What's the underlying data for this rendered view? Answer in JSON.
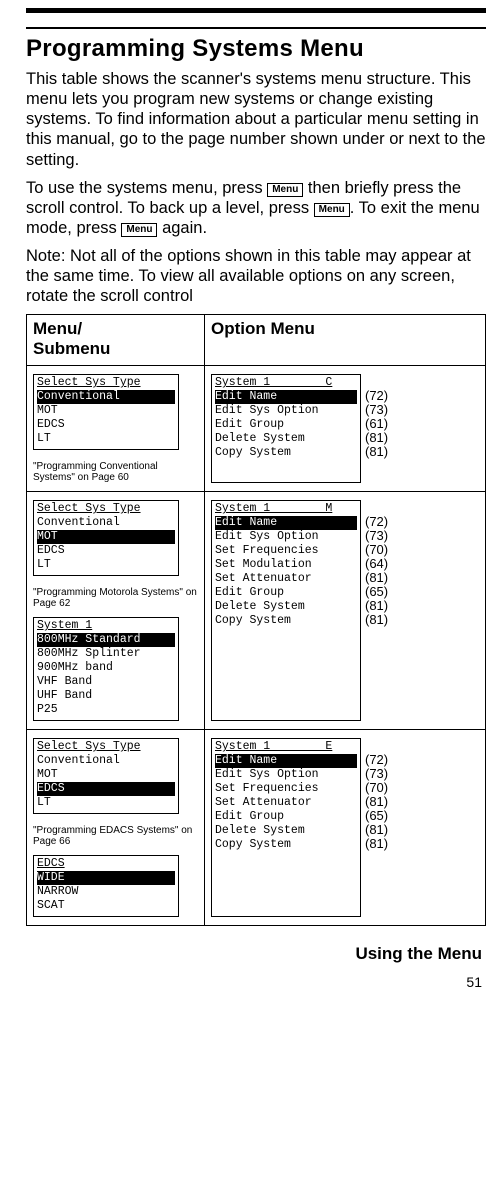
{
  "title": "Programming Systems Menu",
  "para1": "This table shows the scanner's systems menu structure. This menu lets you program new systems or change existing systems. To find information about a particular menu setting in this manual, go to the page number shown under or next to the setting.",
  "para2a": "To use the systems menu, press ",
  "para2b": " then briefly press the scroll control. To back up a level, press ",
  "para2c": ". To exit the menu mode, press ",
  "para2d": " again.",
  "para3": "Note: Not all of the options shown in this table may appear at the same time. To view all available options on any screen, rotate the scroll control",
  "menu_btn": "Menu",
  "col_left_header": "Menu/\nSubmenu",
  "col_right_header": "Option Menu",
  "rows": [
    {
      "type_title": "Select Sys Type",
      "type_items": [
        {
          "t": "Conventional",
          "sel": true
        },
        {
          "t": "MOT"
        },
        {
          "t": "EDCS"
        },
        {
          "t": "LT"
        }
      ],
      "caption": "\"Programming Conventional Systems\" on Page 60",
      "sub_boxes": [],
      "opt_title": "System 1        C",
      "opt_items": [
        {
          "t": "Edit Name",
          "sel": true,
          "pg": "(72)"
        },
        {
          "t": "Edit Sys Option",
          "pg": "(73)"
        },
        {
          "t": "Edit Group",
          "pg": "(61)"
        },
        {
          "t": "Delete System",
          "pg": "(81)"
        },
        {
          "t": "Copy System",
          "pg": "(81)"
        }
      ]
    },
    {
      "type_title": "Select Sys Type",
      "type_items": [
        {
          "t": "Conventional"
        },
        {
          "t": "MOT",
          "sel": true
        },
        {
          "t": "EDCS"
        },
        {
          "t": "LT"
        }
      ],
      "caption": "\"Programming Motorola Systems\" on Page 62",
      "sub_boxes": [
        {
          "title": "System 1",
          "items": [
            {
              "t": "800MHz Standard",
              "sel": true
            },
            {
              "t": "800MHz Splinter"
            },
            {
              "t": "900MHz band"
            },
            {
              "t": "VHF Band"
            },
            {
              "t": "UHF Band"
            },
            {
              "t": "P25"
            }
          ]
        }
      ],
      "opt_title": "System 1        M",
      "opt_items": [
        {
          "t": "Edit Name",
          "sel": true,
          "pg": "(72)"
        },
        {
          "t": "Edit Sys Option",
          "pg": "(73)"
        },
        {
          "t": "Set Frequencies",
          "pg": "(70)"
        },
        {
          "t": "Set Modulation",
          "pg": "(64)"
        },
        {
          "t": "Set Attenuator",
          "pg": "(81)"
        },
        {
          "t": "Edit Group",
          "pg": "(65)"
        },
        {
          "t": "Delete System",
          "pg": "(81)"
        },
        {
          "t": "Copy System",
          "pg": "(81)"
        }
      ]
    },
    {
      "type_title": "Select Sys Type",
      "type_items": [
        {
          "t": "Conventional"
        },
        {
          "t": "MOT"
        },
        {
          "t": "EDCS",
          "sel": true
        },
        {
          "t": "LT"
        }
      ],
      "caption": "\"Programming EDACS Systems\" on Page 66",
      "sub_boxes": [
        {
          "title": "EDCS",
          "items": [
            {
              "t": "WIDE",
              "sel": true
            },
            {
              "t": "NARROW"
            },
            {
              "t": "SCAT"
            }
          ]
        }
      ],
      "opt_title": "System 1        E",
      "opt_items": [
        {
          "t": "Edit Name",
          "sel": true,
          "pg": "(72)"
        },
        {
          "t": "Edit Sys Option",
          "pg": "(73)"
        },
        {
          "t": "Set Frequencies",
          "pg": "(70)"
        },
        {
          "t": "Set Attenuator",
          "pg": "(81)"
        },
        {
          "t": "Edit Group",
          "pg": "(65)"
        },
        {
          "t": "Delete System",
          "pg": "(81)"
        },
        {
          "t": "Copy System",
          "pg": "(81)"
        }
      ]
    }
  ],
  "footer": "Using the Menu",
  "page_number": "51"
}
